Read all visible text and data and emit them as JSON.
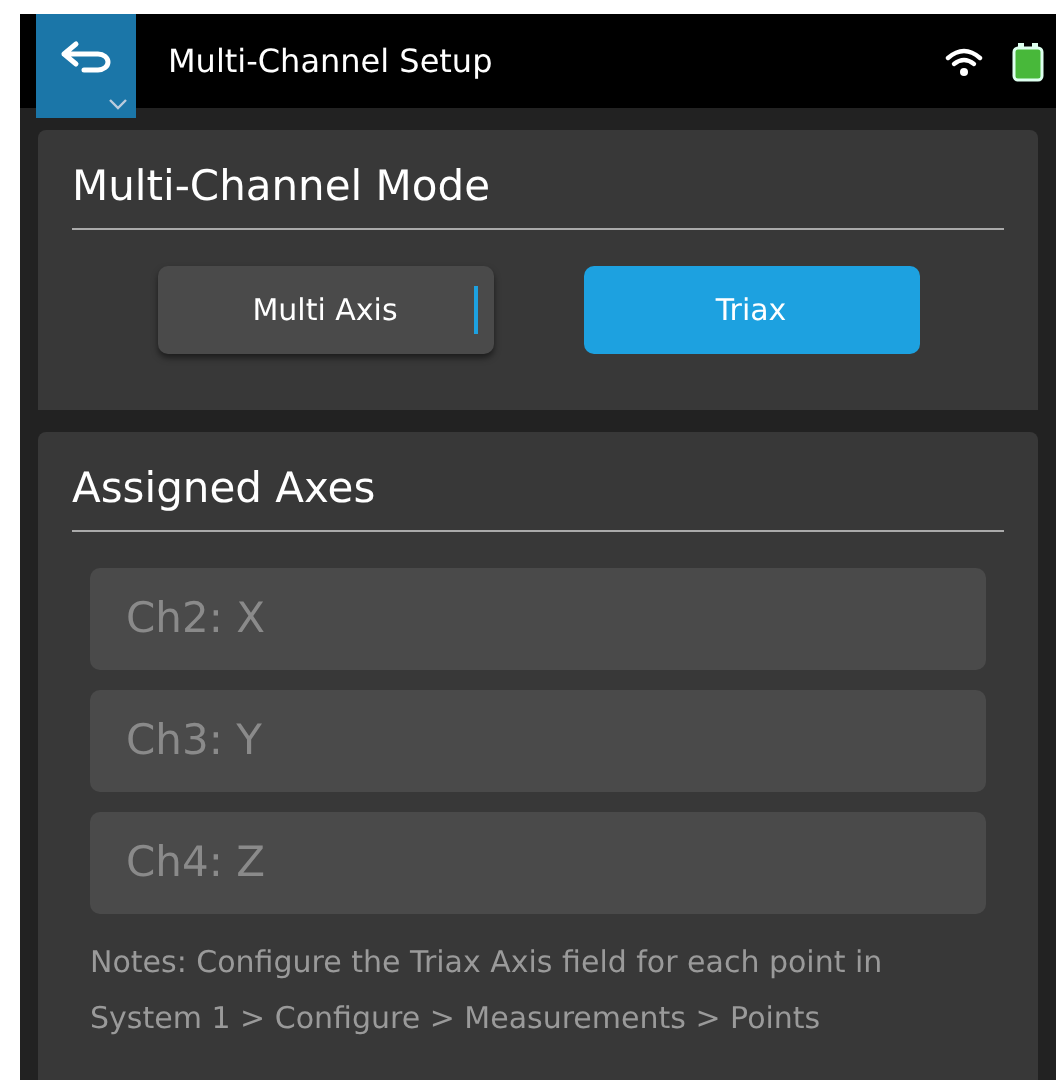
{
  "header": {
    "title": "Multi-Channel Setup"
  },
  "mode_section": {
    "title": "Multi-Channel Mode",
    "options": [
      {
        "label": "Multi Axis",
        "selected": false,
        "focused": true
      },
      {
        "label": "Triax",
        "selected": true,
        "focused": false
      }
    ]
  },
  "axes_section": {
    "title": "Assigned Axes",
    "fields": [
      {
        "value": "Ch2: X",
        "disabled": true
      },
      {
        "value": "Ch3: Y",
        "disabled": true
      },
      {
        "value": "Ch4: Z",
        "disabled": true
      }
    ],
    "notes": "Notes: Configure the Triax Axis field for each point in System 1 > Configure > Measurements > Points"
  }
}
